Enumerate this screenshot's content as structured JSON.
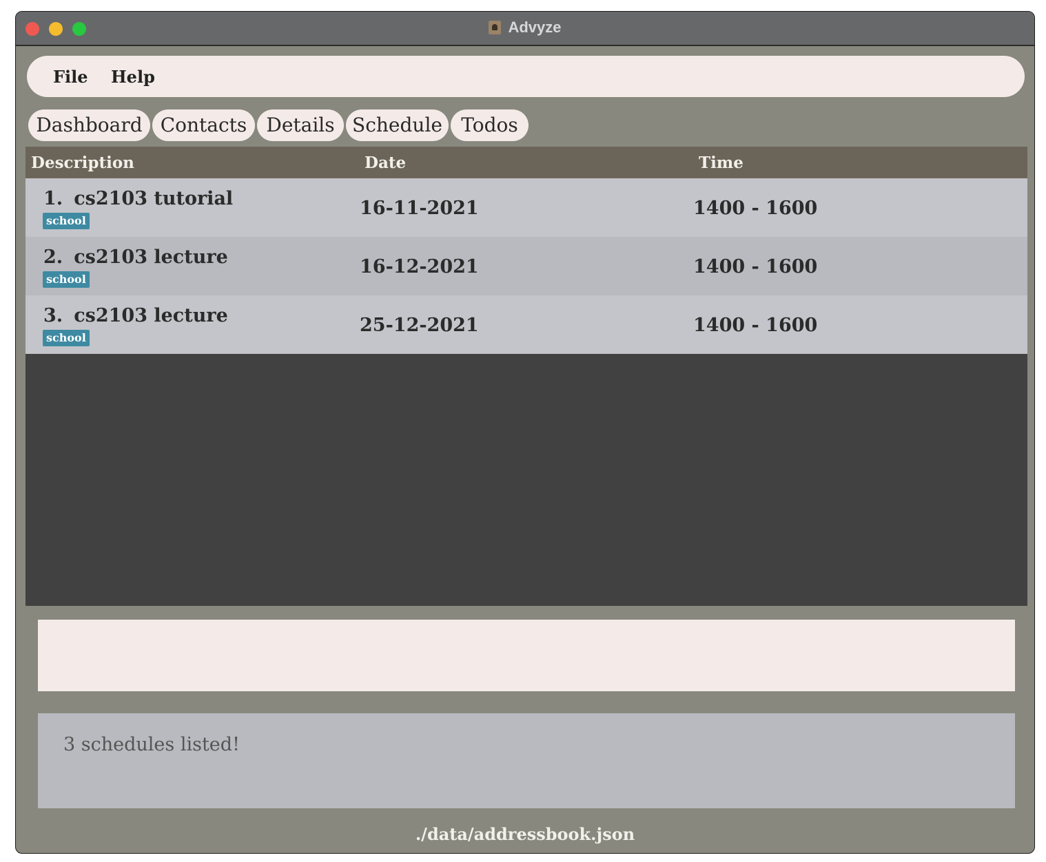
{
  "window": {
    "title": "Advyze"
  },
  "menubar": {
    "file": "File",
    "help": "Help"
  },
  "tabs": [
    {
      "label": "Dashboard"
    },
    {
      "label": "Contacts"
    },
    {
      "label": "Details"
    },
    {
      "label": "Schedule"
    },
    {
      "label": "Todos"
    }
  ],
  "table": {
    "headers": {
      "description": "Description",
      "date": "Date",
      "time": "Time"
    },
    "rows": [
      {
        "index": "1.",
        "description": "cs2103 tutorial",
        "tag": "school",
        "date": "16-11-2021",
        "time": "1400 - 1600"
      },
      {
        "index": "2.",
        "description": "cs2103 lecture",
        "tag": "school",
        "date": "16-12-2021",
        "time": "1400 - 1600"
      },
      {
        "index": "3.",
        "description": "cs2103 lecture",
        "tag": "school",
        "date": "25-12-2021",
        "time": "1400 - 1600"
      }
    ]
  },
  "command": {
    "value": ""
  },
  "result": {
    "message": "3 schedules listed!"
  },
  "status": {
    "path": "./data/addressbook.json"
  },
  "colors": {
    "tag": "#3e8aa2",
    "header": "#6b6458",
    "background": "#88887e"
  }
}
